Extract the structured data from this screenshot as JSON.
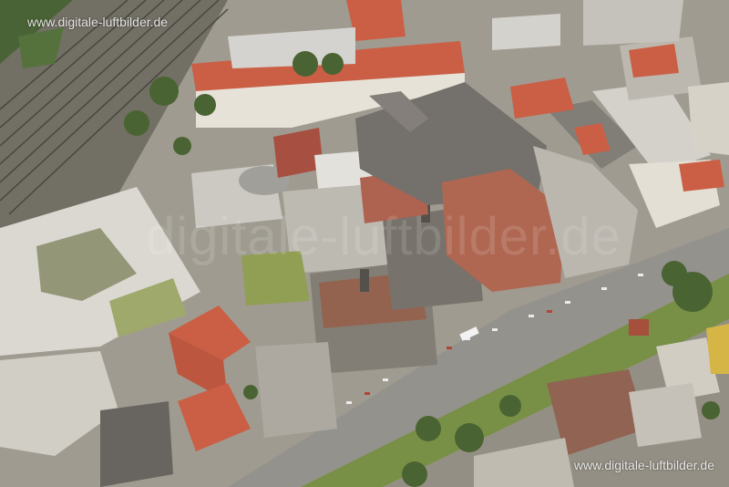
{
  "image": {
    "subject": "Aerial photograph of a city block with railway tracks, large institutional buildings and a busy avenue"
  },
  "watermark": {
    "top_left": "www.digitale-luftbilder.de",
    "bottom_right": "www.digitale-luftbilder.de",
    "center": "digitale-luftbilder.de"
  },
  "colors": {
    "roof_red": "#c8563a",
    "roof_grey": "#7a7670",
    "greenery": "#4f6b2e",
    "road": "#8a8a84",
    "rail": "#5d5a52"
  }
}
